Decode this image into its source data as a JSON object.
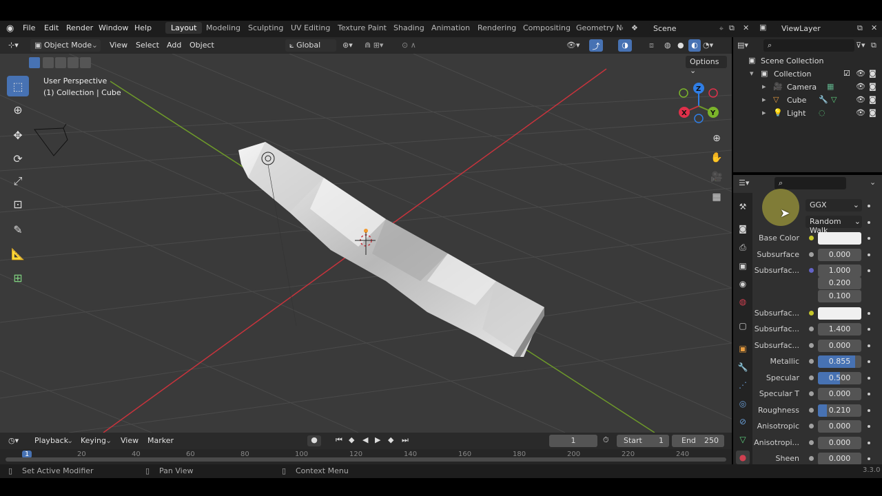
{
  "topmenu": {
    "file": "File",
    "edit": "Edit",
    "render": "Render",
    "window": "Window",
    "help": "Help"
  },
  "workspaces": [
    "Layout",
    "Modeling",
    "Sculpting",
    "UV Editing",
    "Texture Paint",
    "Shading",
    "Animation",
    "Rendering",
    "Compositing",
    "Geometry Noc"
  ],
  "scene": "Scene",
  "view_layer": "ViewLayer",
  "viewport_header": {
    "mode": "Object Mode",
    "view": "View",
    "select": "Select",
    "add": "Add",
    "object": "Object",
    "orientation": "Global",
    "options": "Options"
  },
  "viewport_info": {
    "perspective": "User Perspective",
    "collection": "(1) Collection | Cube"
  },
  "gizmo": {
    "x": "X",
    "y": "Y",
    "z": "Z"
  },
  "outliner": {
    "scene_collection": "Scene Collection",
    "collection": "Collection",
    "items": [
      {
        "name": "Camera"
      },
      {
        "name": "Cube"
      },
      {
        "name": "Light"
      }
    ]
  },
  "material": {
    "distribution": "GGX",
    "subsurface_method": "Random Walk",
    "rows": [
      {
        "label": "Base Color",
        "value": "",
        "type": "color"
      },
      {
        "label": "Subsurface",
        "value": "0.000"
      },
      {
        "label": "Subsurfac...",
        "value": "1.000"
      },
      {
        "label": "",
        "value": "0.200"
      },
      {
        "label": "",
        "value": "0.100"
      },
      {
        "label": "Subsurfac...",
        "value": "",
        "type": "color"
      },
      {
        "label": "Subsurfac...",
        "value": "1.400"
      },
      {
        "label": "Subsurfac...",
        "value": "0.000"
      },
      {
        "label": "Metallic",
        "value": "0.855",
        "fill": 0.855
      },
      {
        "label": "Specular",
        "value": "0.500",
        "fill": 0.5
      },
      {
        "label": "Specular T",
        "value": "0.000"
      },
      {
        "label": "Roughness",
        "value": "0.210",
        "fill": 0.21
      },
      {
        "label": "Anisotropic",
        "value": "0.000"
      },
      {
        "label": "Anisotropi...",
        "value": "0.000"
      },
      {
        "label": "Sheen",
        "value": "0.000"
      }
    ]
  },
  "timeline": {
    "playback": "Playback",
    "keying": "Keying",
    "view": "View",
    "marker": "Marker",
    "current_frame": "1",
    "start_label": "Start",
    "start": "1",
    "end_label": "End",
    "end": "250"
  },
  "ruler_ticks": [
    "1",
    "20",
    "40",
    "60",
    "80",
    "100",
    "120",
    "140",
    "160",
    "180",
    "200",
    "220",
    "240"
  ],
  "statusbar": {
    "left": "Set Active Modifier",
    "middle": "Pan View",
    "right": "Context Menu",
    "version": "3.3.0"
  },
  "colors": {
    "accent": "#4772b3",
    "x_axis": "#c8333c",
    "y_axis": "#6e9a2a",
    "z_axis": "#2f7ee6"
  }
}
